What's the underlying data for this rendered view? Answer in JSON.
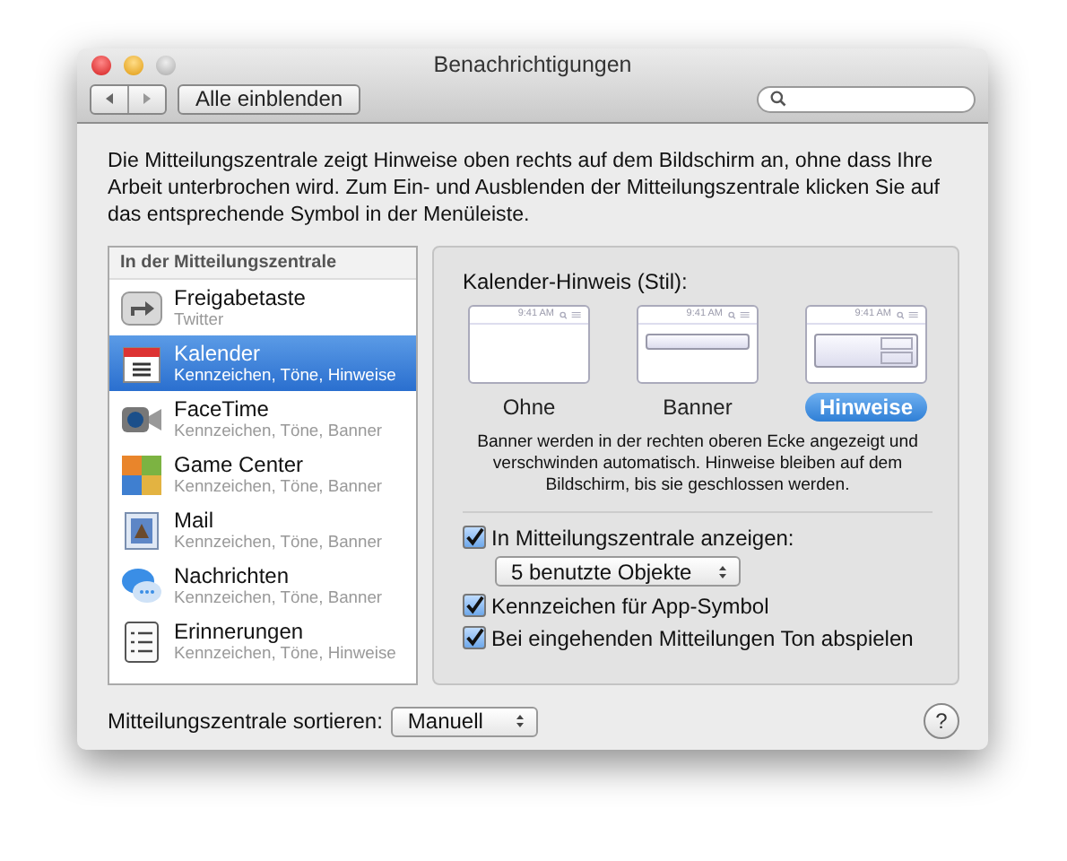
{
  "window": {
    "title": "Benachrichtigungen"
  },
  "toolbar": {
    "show_all_button": "Alle einblenden"
  },
  "description": "Die Mitteilungszentrale zeigt Hinweise oben rechts auf dem Bildschirm an, ohne dass Ihre Arbeit unterbrochen wird. Zum Ein- und Ausblenden der Mitteilungszentrale klicken Sie auf das entsprechende Symbol in der Menüleiste.",
  "sidebar": {
    "header": "In der Mitteilungszentrale",
    "items": [
      {
        "name": "Freigabetaste",
        "detail": "Twitter",
        "selected": false
      },
      {
        "name": "Kalender",
        "detail": "Kennzeichen, Töne, Hinweise",
        "selected": true
      },
      {
        "name": "FaceTime",
        "detail": "Kennzeichen, Töne, Banner",
        "selected": false
      },
      {
        "name": "Game Center",
        "detail": "Kennzeichen, Töne, Banner",
        "selected": false
      },
      {
        "name": "Mail",
        "detail": "Kennzeichen, Töne, Banner",
        "selected": false
      },
      {
        "name": "Nachrichten",
        "detail": "Kennzeichen, Töne, Banner",
        "selected": false
      },
      {
        "name": "Erinnerungen",
        "detail": "Kennzeichen, Töne, Hinweise",
        "selected": false
      }
    ]
  },
  "style_panel": {
    "heading": "Kalender-Hinweis (Stil):",
    "options": [
      {
        "kind": "none",
        "label": "Ohne",
        "clock": "9:41 AM",
        "selected": false
      },
      {
        "kind": "banner",
        "label": "Banner",
        "clock": "9:41 AM",
        "selected": false
      },
      {
        "kind": "alert",
        "label": "Hinweise",
        "clock": "9:41 AM",
        "selected": true
      }
    ],
    "note": "Banner werden in der rechten oberen Ecke angezeigt und verschwinden automatisch. Hinweise bleiben auf dem Bildschirm, bis sie geschlossen werden."
  },
  "settings": [
    {
      "kind": "checkbox",
      "label": "In Mitteilungszentrale anzeigen:",
      "checked": true
    },
    {
      "kind": "select",
      "value": "5 benutzte Objekte"
    },
    {
      "kind": "checkbox",
      "label": "Kennzeichen für App-Symbol",
      "checked": true
    },
    {
      "kind": "checkbox",
      "label": "Bei eingehenden Mitteilungen Ton abspielen",
      "checked": true
    }
  ],
  "footer": {
    "sort_label": "Mitteilungszentrale sortieren:",
    "sort_value": "Manuell",
    "help_button": "?"
  }
}
